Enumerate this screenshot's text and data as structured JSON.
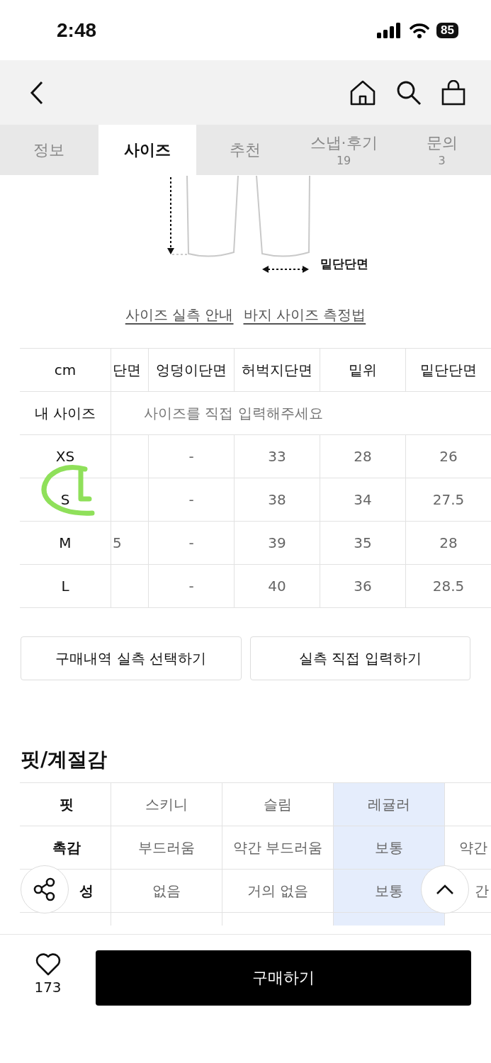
{
  "status_bar": {
    "time": "2:48",
    "battery": "85"
  },
  "tabs": [
    {
      "label": "정보",
      "selected": false
    },
    {
      "label": "사이즈",
      "selected": true
    },
    {
      "label": "추천",
      "selected": false
    },
    {
      "label": "스냅·후기",
      "count": "19",
      "selected": false
    },
    {
      "label": "문의",
      "count": "3",
      "selected": false
    }
  ],
  "diagram": {
    "label": "밑단단면"
  },
  "guide_links": [
    "사이즈 실측 안내",
    "바지 사이즈 측정법"
  ],
  "size_table": {
    "unit": "cm",
    "columns": [
      "단면",
      "엉덩이단면",
      "허벅지단면",
      "밑위",
      "밑단단면"
    ],
    "my_size": {
      "label": "내 사이즈",
      "placeholder": "사이즈를 직접 입력해주세요"
    },
    "rows": [
      {
        "size": "XS",
        "cells": [
          "",
          "-",
          "33",
          "28",
          "26"
        ]
      },
      {
        "size": "S",
        "cells": [
          "",
          "-",
          "38",
          "34",
          "27.5"
        ]
      },
      {
        "size": "M",
        "cells": [
          "5",
          "-",
          "39",
          "35",
          "28"
        ]
      },
      {
        "size": "L",
        "cells": [
          "",
          "-",
          "40",
          "36",
          "28.5"
        ]
      }
    ]
  },
  "size_buttons": [
    "구매내역 실측 선택하기",
    "실측 직접 입력하기"
  ],
  "fit_section": {
    "title": "핏/계절감",
    "rows": [
      {
        "label": "핏",
        "cells": [
          {
            "text": "스키니",
            "selected": false
          },
          {
            "text": "슬림",
            "selected": false
          },
          {
            "text": "레귤러",
            "selected": true
          }
        ]
      },
      {
        "label": "촉감",
        "cut_cell": "약간",
        "cells": [
          {
            "text": "부드러움",
            "selected": false
          },
          {
            "text": "약간 부드러움",
            "selected": false
          },
          {
            "text": "보통",
            "selected": true
          }
        ]
      },
      {
        "label": "성",
        "cut_cell": "간",
        "cells": [
          {
            "text": "없음",
            "selected": false
          },
          {
            "text": "거의 없음",
            "selected": false
          },
          {
            "text": "보통",
            "selected": true
          }
        ]
      }
    ]
  },
  "bottom_bar": {
    "likes": "173",
    "buy_button": "구매하기"
  }
}
